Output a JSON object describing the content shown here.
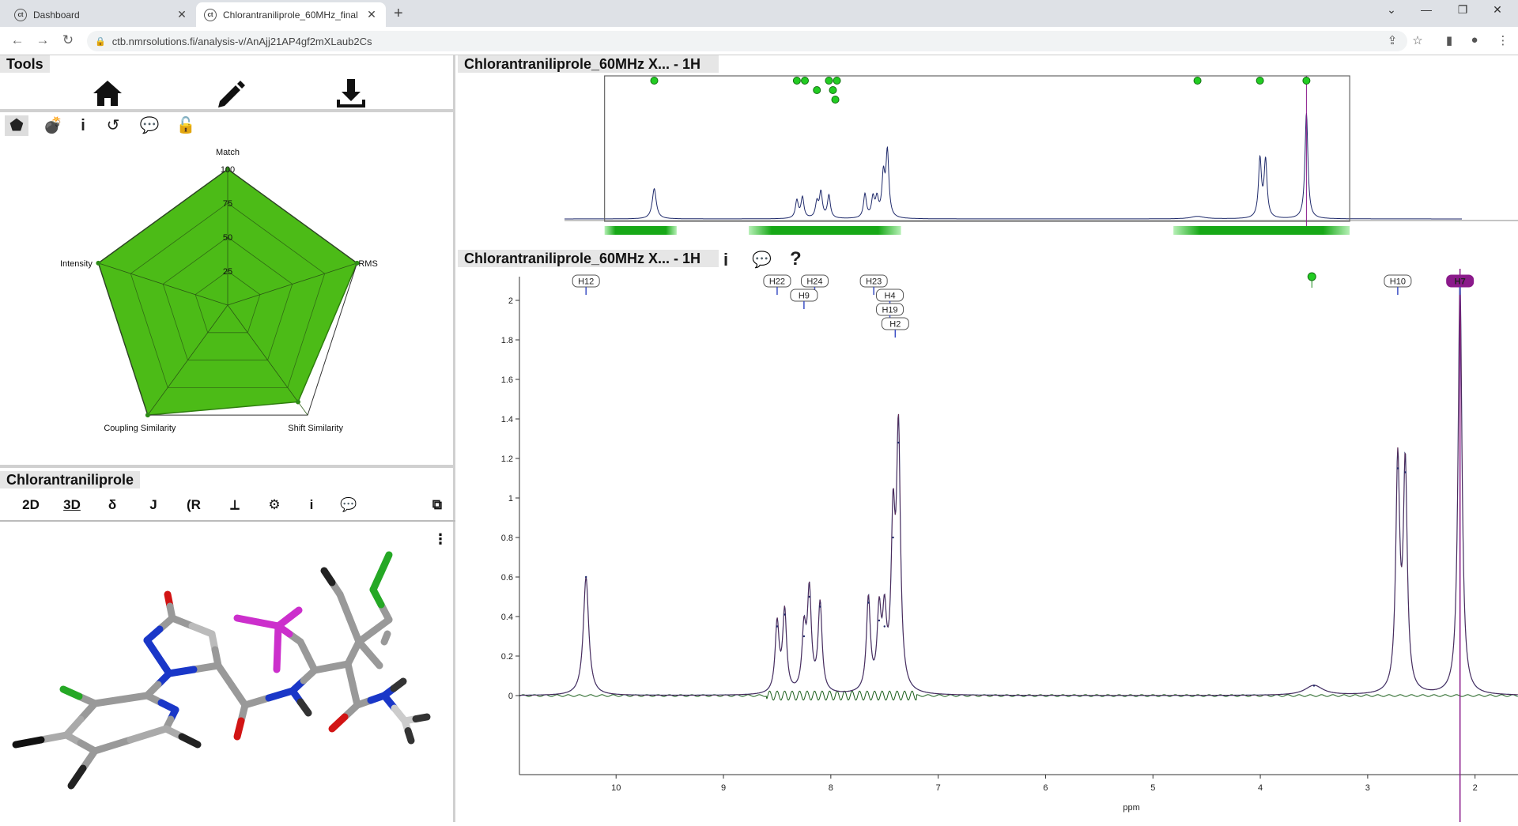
{
  "browser": {
    "tabs": [
      {
        "title": "Dashboard"
      },
      {
        "title": "Chlorantraniliprole_60MHz_final"
      }
    ],
    "url": "ctb.nmrsolutions.fi/analysis-v/AnAjj21AP4gf2mXLaub2Cs"
  },
  "tools": {
    "title": "Tools",
    "buttons": [
      "home-icon",
      "pencil-icon",
      "download-icon"
    ],
    "subicons": [
      "pentagon-icon",
      "bomb-icon",
      "info-icon",
      "history-icon",
      "comments-icon",
      "unlock-icon"
    ]
  },
  "radar": {
    "labels": {
      "top": "Match",
      "right": "RMS",
      "bottom_right": "Shift Similarity",
      "bottom_left": "Coupling Similarity",
      "left": "Intensity"
    },
    "scale_ticks": [
      "100",
      "75",
      "50",
      "25"
    ],
    "values": {
      "match": 100,
      "rms": 100,
      "shift_similarity": 88,
      "coupling_similarity": 100,
      "intensity": 100
    },
    "fill_color": "#4cbb17"
  },
  "molecule": {
    "title": "Chlorantraniliprole",
    "buttons": [
      "2D",
      "3D",
      "δ",
      "J",
      "R-icon",
      "coupling-icon",
      "settings-icon",
      "info-icon",
      "comment-icon"
    ],
    "selected_button": "3D"
  },
  "overview": {
    "title": "Chlorantraniliprole_60MHz X... - 1H"
  },
  "spectrum": {
    "title": "Chlorantraniliprole_60MHz X... - 1H",
    "xlabel": "ppm",
    "x_ticks": [
      "10",
      "9",
      "8",
      "7",
      "6",
      "5",
      "4",
      "3",
      "2"
    ],
    "y_ticks": [
      "2",
      "1.8",
      "1.6",
      "1.4",
      "1.2",
      "1",
      "0.8",
      "0.6",
      "0.4",
      "0.2",
      "0"
    ],
    "atom_labels": [
      "H12",
      "H22",
      "H24",
      "H9",
      "H23",
      "H4",
      "H19",
      "H2",
      "H10",
      "H7"
    ],
    "highlight_label": "H7",
    "highlight_color": "#8b1a8b"
  },
  "chart_data": {
    "type": "line",
    "xlabel": "ppm",
    "ylabel": "",
    "xlim": [
      10.9,
      1.6
    ],
    "ylim": [
      -0.1,
      2.1
    ],
    "series": [
      {
        "values": [
          [
            10.28,
            0.6
          ],
          [
            8.5,
            0.35
          ],
          [
            8.43,
            0.41
          ],
          [
            8.25,
            0.3
          ],
          [
            8.2,
            0.5
          ],
          [
            8.1,
            0.45
          ],
          [
            7.65,
            0.47
          ],
          [
            7.55,
            0.38
          ],
          [
            7.5,
            0.35
          ],
          [
            7.42,
            0.8
          ],
          [
            7.37,
            1.28
          ],
          [
            3.5,
            0.05
          ],
          [
            2.72,
            1.15
          ],
          [
            2.65,
            1.13
          ],
          [
            2.14,
            2.1
          ]
        ]
      }
    ]
  }
}
